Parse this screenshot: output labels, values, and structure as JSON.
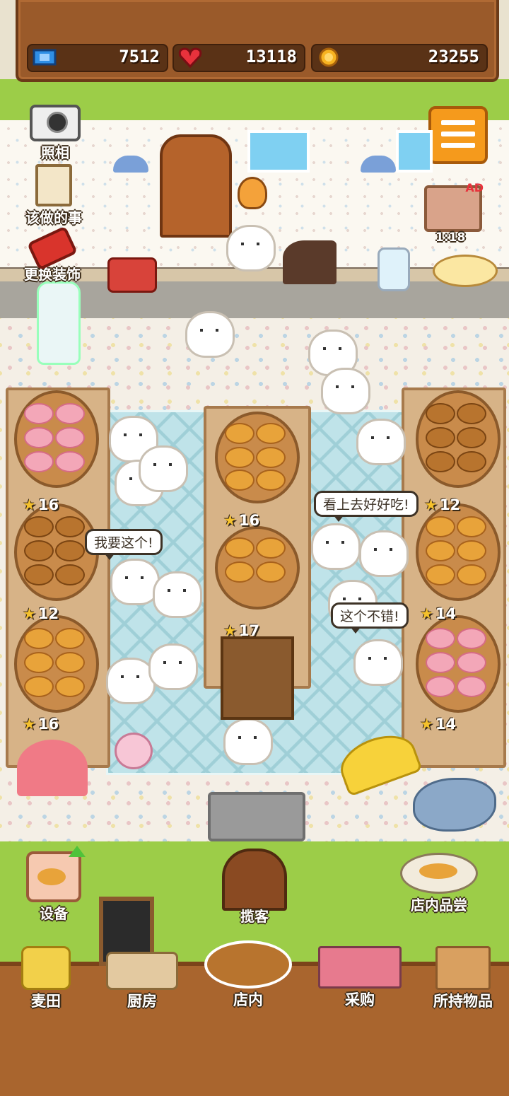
{
  "resources": {
    "tickets": "7512",
    "hearts": "13118",
    "coins": "23255"
  },
  "side_buttons": {
    "camera": "照相",
    "todo": "该做的事",
    "decor": "更换装饰"
  },
  "ad_tv": {
    "badge": "AD",
    "timer": "1:18"
  },
  "speech": {
    "b1": "看上去好好吃!",
    "b2": "我要这个!",
    "b3": "这个不错!"
  },
  "stock_counts": {
    "left_top": "16",
    "left_mid": "12",
    "left_bot": "16",
    "center_top": "16",
    "center_bot": "17",
    "right_top": "12",
    "right_mid": "14",
    "right_bot": "14"
  },
  "action_buttons": {
    "equipment": "设备",
    "invite": "揽客",
    "tasting": "店内品尝"
  },
  "nav": {
    "wheat_field": "麦田",
    "kitchen": "厨房",
    "in_store": "店内",
    "purchase": "采购",
    "inventory": "所持物品"
  },
  "colors": {
    "grass": "#9ccd48",
    "wood": "#a9652e",
    "menu_orange": "#f59a1c"
  }
}
